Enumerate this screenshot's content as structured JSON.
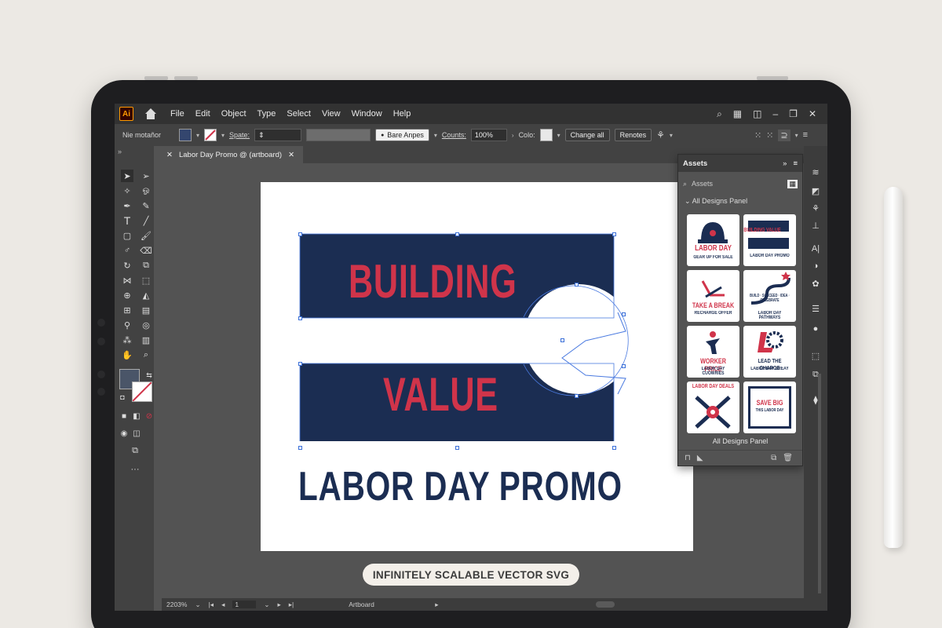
{
  "menubar": {
    "items": [
      "File",
      "Edit",
      "Object",
      "Type",
      "Select",
      "View",
      "Window",
      "Help"
    ]
  },
  "control_bar": {
    "left_label": "Nie motañor",
    "stroke_label": "Spate:",
    "brush_name": "Bare Anpes",
    "counts_label": "Counts:",
    "counts_value": "100%",
    "color_label": "Colo:",
    "change_all": "Change all",
    "renotes": "Renotes"
  },
  "document": {
    "tab_title": "Labor Day Promo @ (artboard)"
  },
  "artboard": {
    "headline_top": "BUILDING",
    "headline_bottom": "VALUE",
    "promo": "LABOR DAY PROMO"
  },
  "assets_panel": {
    "tab": "Assets",
    "search_placeholder": "Assets",
    "group_name": "All Designs Panel",
    "footer_label": "All Designs Panel",
    "thumbnails": [
      {
        "title": "LABOR DAY",
        "sub": "GEAR UP FOR SALE"
      },
      {
        "title": "BUILDING VALUE",
        "sub": "LABOR DAY PROMO"
      },
      {
        "title": "TAKE A BREAK",
        "sub": "RECHARGE OFFER"
      },
      {
        "title": "BUILD · SUCCEED · IDEA · CELEBRATE",
        "sub": "LABOR DAY PATHWAYS"
      },
      {
        "title": "WORKER PRICE",
        "sub": "LABOR DAY CUOWRIES"
      },
      {
        "title": "LEAD THE CHARCE",
        "sub": "LABOR DAY BREAY"
      },
      {
        "title": "LABOR DAY DEALS",
        "sub": ""
      },
      {
        "title": "SAVE BIG",
        "sub": "THIS LABOR DAY"
      }
    ]
  },
  "statusbar": {
    "zoom": "2203%",
    "page": "1",
    "mode": "Artboard"
  },
  "caption": "INFINITELY SCALABLE VECTOR SVG",
  "colors": {
    "navy": "#1b2d52",
    "red": "#d0344a",
    "ui_dark": "#323232",
    "ui_mid": "#535353"
  }
}
